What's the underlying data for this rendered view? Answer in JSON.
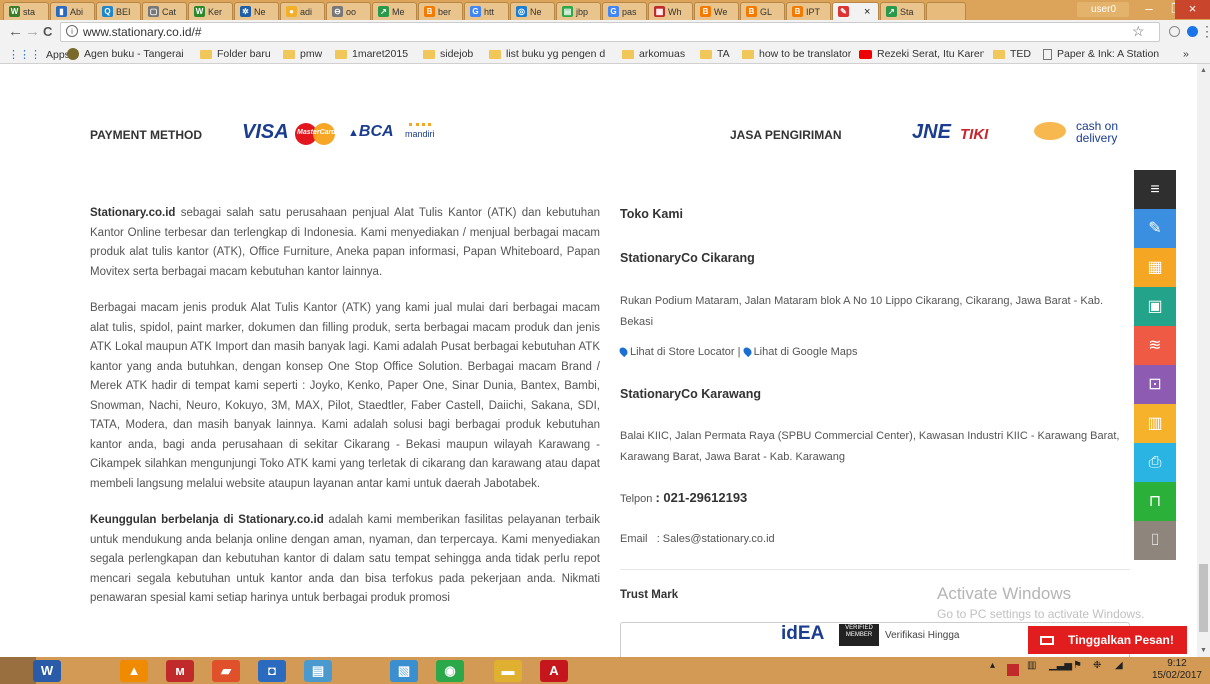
{
  "browser": {
    "tabs": [
      {
        "label": "sta",
        "icon_color": "#3a7d2a",
        "icon": "W"
      },
      {
        "label": "Abi",
        "icon_color": "#2a6bbf",
        "icon": "▮"
      },
      {
        "label": "BEI",
        "icon_color": "#1f86c9",
        "icon": "Q"
      },
      {
        "label": "Cat",
        "icon_color": "#777777",
        "icon": "▢"
      },
      {
        "label": "Ker",
        "icon_color": "#2a8a2a",
        "icon": "W"
      },
      {
        "label": "Ne",
        "icon_color": "#1f5fa8",
        "icon": "✲"
      },
      {
        "label": "adi",
        "icon_color": "#f2b02a",
        "icon": "●"
      },
      {
        "label": "oo",
        "icon_color": "#777777",
        "icon": "⊖"
      },
      {
        "label": "Me",
        "icon_color": "#2a9a4a",
        "icon": "↗"
      },
      {
        "label": "ber",
        "icon_color": "#f57a00",
        "icon": "B"
      },
      {
        "label": "htt",
        "icon_color": "#4285f4",
        "icon": "G"
      },
      {
        "label": "Ne",
        "icon_color": "#1a7fd1",
        "icon": "◎"
      },
      {
        "label": "jbp",
        "icon_color": "#2aa84a",
        "icon": "▤"
      },
      {
        "label": "pas",
        "icon_color": "#4285f4",
        "icon": "G"
      },
      {
        "label": "Wh",
        "icon_color": "#c02a2a",
        "icon": "▦"
      },
      {
        "label": "We",
        "icon_color": "#f57a00",
        "icon": "B"
      },
      {
        "label": "GL",
        "icon_color": "#f57a00",
        "icon": "B"
      },
      {
        "label": "IPT",
        "icon_color": "#f57a00",
        "icon": "B"
      },
      {
        "label": "",
        "icon_color": "#d33",
        "icon": "✎",
        "close": "×"
      },
      {
        "label": "Sta",
        "icon_color": "#2a9a4a",
        "icon": "↗"
      }
    ],
    "user": "user0",
    "minimize": "–",
    "maximize": "❐",
    "close": "×",
    "back": "←",
    "forward": "→",
    "reload": "C",
    "url": "www.stationary.co.id/#",
    "star": "☆",
    "menu": "⋮",
    "bookmarks": [
      {
        "label": "Apps",
        "type": "apps"
      },
      {
        "label": "Agen buku - Tangerai",
        "type": "site"
      },
      {
        "label": "Folder baru",
        "type": "folder"
      },
      {
        "label": "pmw",
        "type": "folder"
      },
      {
        "label": "1maret2015",
        "type": "folder"
      },
      {
        "label": "sidejob",
        "type": "folder"
      },
      {
        "label": "list buku yg pengen d",
        "type": "folder"
      },
      {
        "label": "arkomuas",
        "type": "folder"
      },
      {
        "label": "TA",
        "type": "folder"
      },
      {
        "label": "how to be translator",
        "type": "folder"
      },
      {
        "label": "Rezeki Serat, Itu Karen",
        "type": "yt"
      },
      {
        "label": "TED",
        "type": "folder"
      },
      {
        "label": "Paper & Ink: A Station",
        "type": "page"
      }
    ],
    "more_bookmarks": "»"
  },
  "page": {
    "payment": {
      "label": "PAYMENT METHOD",
      "visa": "VISA",
      "mastercard": "MasterCard",
      "bca": "BCA",
      "mandiri": "mandiri"
    },
    "shipping": {
      "label": "JASA PENGIRIMAN",
      "jne": "JNE",
      "tiki": "TIKI",
      "cod_line1": "cash on",
      "cod_line2": "delivery"
    },
    "about": {
      "p1_bold": "Stationary.co.id",
      "p1": " sebagai salah satu perusahaan penjual Alat Tulis Kantor (ATK) dan kebutuhan Kantor Online terbesar dan terlengkap di Indonesia. Kami menyediakan / menjual berbagai macam produk alat tulis kantor (ATK), Office Furniture, Aneka papan informasi, Papan Whiteboard, Papan Movitex serta berbagai macam kebutuhan kantor lainnya.",
      "p2": "Berbagai macam jenis produk Alat Tulis Kantor (ATK) yang kami jual mulai dari berbagai macam alat tulis, spidol, paint marker, dokumen dan filling produk, serta berbagai macam produk dan jenis ATK Lokal maupun ATK Import dan masih banyak lagi. Kami adalah Pusat berbagai kebutuhan ATK kantor yang anda butuhkan, dengan konsep One Stop Office Solution. Berbagai macam Brand / Merek ATK hadir di tempat kami seperti : Joyko, Kenko, Paper One, Sinar Dunia, Bantex, Bambi, Snowman, Nachi, Neuro, Kokuyo, 3M, MAX, Pilot, Staedtler, Faber Castell, Daiichi, Sakana, SDI, TATA, Modera, dan masih banyak lainnya.  Kami adalah solusi bagi berbagai produk kebutuhan kantor anda, bagi anda perusahaan di sekitar Cikarang - Bekasi maupun wilayah Karawang - Cikampek silahkan mengunjungi Toko ATK kami yang terletak di cikarang dan karawang atau dapat membeli langsung melalui website ataupun layanan antar kami untuk daerah Jabotabek.",
      "p3_bold": "Keunggulan berbelanja di Stationary.co.id",
      "p3": " adalah kami memberikan fasilitas pelayanan terbaik untuk mendukung anda belanja online dengan aman, nyaman, dan terpercaya. Kami menyediakan segala perlengkapan dan kebutuhan kantor di dalam satu tempat sehingga anda tidak perlu repot mencari segala kebutuhan untuk kantor anda dan bisa terfokus pada pekerjaan anda. Nikmati penawaran spesial kami setiap harinya untuk berbagai produk promosi"
    },
    "stores": {
      "heading": "Toko Kami",
      "cikarang_name": "StationaryCo Cikarang",
      "cikarang_addr": "Rukan Podium Mataram, Jalan Mataram blok A No 10 Lippo Cikarang, Cikarang, Jawa Barat - Kab. Bekasi",
      "store_locator": "Lihat di Store Locator",
      "separator": "|",
      "google_maps": "Lihat di Google Maps",
      "karawang_name": "StationaryCo Karawang",
      "karawang_addr": "Balai KIIC, Jalan Permata Raya (SPBU Commercial Center), Kawasan Industri KIIC - Karawang Barat, Karawang Barat, Jawa Barat - Kab. Karawang",
      "telp_label": "Telpon",
      "telp_value": ": 021-29612193",
      "email_label": "Email",
      "email_value": ": Sales@stationary.co.id",
      "trust_label": "Trust Mark",
      "idea_id": "id",
      "idea_ea": "EA",
      "verified": "VERIFIED MEMBER",
      "verifikasi": "Verifikasi Hingga"
    },
    "watermark": {
      "title": "Activate Windows",
      "sub": "Go to PC settings to activate Windows."
    },
    "sidebar_icons": [
      {
        "name": "menu-icon",
        "glyph": "≡",
        "color": "#2f2f2f"
      },
      {
        "name": "pencil-icon",
        "glyph": "✎",
        "color": "#3a8fe0"
      },
      {
        "name": "grid-icon",
        "glyph": "▦",
        "color": "#f5a623"
      },
      {
        "name": "monitor-icon",
        "glyph": "▣",
        "color": "#23a48a"
      },
      {
        "name": "paper-stack-icon",
        "glyph": "≋",
        "color": "#ef5a45"
      },
      {
        "name": "board-icon",
        "glyph": "⊡",
        "color": "#8e5bb3"
      },
      {
        "name": "cabinet-icon",
        "glyph": "▥",
        "color": "#f5b22a"
      },
      {
        "name": "printer-icon",
        "glyph": "⎙",
        "color": "#2ab4e4"
      },
      {
        "name": "desk-icon",
        "glyph": "⊓",
        "color": "#2bb03a"
      },
      {
        "name": "bottle-icon",
        "glyph": "⌷",
        "color": "#8e857c"
      }
    ],
    "contact_button": "Tinggalkan Pesan!"
  },
  "taskbar": {
    "clock_time": "9:12",
    "clock_date": "15/02/2017",
    "apps": [
      {
        "name": "word-icon",
        "glyph": "W",
        "color": "#2a5ba8"
      },
      {
        "name": "vlc-icon",
        "glyph": "▲",
        "color": "#f08a00"
      },
      {
        "name": "app-red-icon",
        "glyph": "ᴍ",
        "color": "#c02a2a"
      },
      {
        "name": "book-icon",
        "glyph": "▰",
        "color": "#e0502a"
      },
      {
        "name": "media-icon",
        "glyph": "◘",
        "color": "#2a6bbf"
      },
      {
        "name": "notes-icon",
        "glyph": "▤",
        "color": "#4a9ad0"
      },
      {
        "name": "files-icon",
        "glyph": "▧",
        "color": "#3a8fd0"
      },
      {
        "name": "chrome-icon",
        "glyph": "◉",
        "color": "#2aa84a"
      },
      {
        "name": "folder-icon",
        "glyph": "▬",
        "color": "#e0b030"
      },
      {
        "name": "acrobat-icon",
        "glyph": "A",
        "color": "#c4161c"
      }
    ]
  }
}
